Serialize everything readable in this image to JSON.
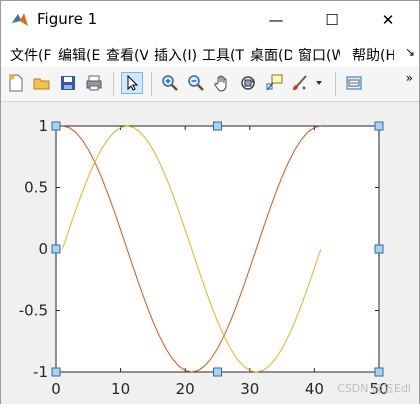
{
  "window": {
    "title": "Figure 1",
    "minimize_glyph": "—",
    "maximize_glyph": "☐",
    "close_glyph": "✕"
  },
  "menu": {
    "items": [
      "文件(F)",
      "编辑(E)",
      "查看(V)",
      "插入(I)",
      "工具(T)",
      "桌面(D)",
      "窗口(W)",
      "帮助(H)"
    ],
    "overflow_glyph": "↘"
  },
  "toolbar": {
    "buttons": [
      "new-figure-icon",
      "open-file-icon",
      "save-icon",
      "print-icon",
      "select-arrow-icon",
      "zoom-in-icon",
      "zoom-out-icon",
      "pan-hand-icon",
      "rotate-3d-icon",
      "data-cursor-icon",
      "brush-icon",
      "link-plot-icon"
    ],
    "more_glyph": "»"
  },
  "colors": {
    "series_cos": "#d95319",
    "series_sin": "#edb120",
    "handle_fill": "#a8d2f2",
    "handle_stroke": "#2b6cb0"
  },
  "chart_data": {
    "type": "line",
    "title": "",
    "xlabel": "",
    "ylabel": "",
    "xlim": [
      0,
      50
    ],
    "ylim": [
      -1,
      1
    ],
    "xticks": [
      0,
      10,
      20,
      30,
      40,
      50
    ],
    "yticks": [
      1,
      0.5,
      0,
      -0.5,
      -1
    ],
    "xtick_labels": [
      "0",
      "10",
      "20",
      "30",
      "40",
      "50"
    ],
    "ytick_labels": [
      "1",
      "0.5",
      "0",
      "-0.5",
      "-1"
    ],
    "grid": false,
    "series": [
      {
        "color": "#d95319",
        "x": [
          1,
          2,
          3,
          4,
          5,
          6,
          7,
          8,
          9,
          10,
          11,
          12,
          13,
          14,
          15,
          16,
          17,
          18,
          19,
          20,
          21,
          22,
          23,
          24,
          25,
          26,
          27,
          28,
          29,
          30,
          31,
          32,
          33,
          34,
          35,
          36,
          37,
          38,
          39,
          40,
          41
        ],
        "y": [
          1.0,
          0.988,
          0.951,
          0.891,
          0.809,
          0.707,
          0.588,
          0.454,
          0.309,
          0.156,
          0.0,
          -0.156,
          -0.309,
          -0.454,
          -0.588,
          -0.707,
          -0.809,
          -0.891,
          -0.951,
          -0.988,
          -1.0,
          -0.988,
          -0.951,
          -0.891,
          -0.809,
          -0.707,
          -0.588,
          -0.454,
          -0.309,
          -0.156,
          0.0,
          0.156,
          0.309,
          0.454,
          0.588,
          0.707,
          0.809,
          0.891,
          0.951,
          0.988,
          1.0
        ]
      },
      {
        "color": "#edb120",
        "x": [
          1,
          2,
          3,
          4,
          5,
          6,
          7,
          8,
          9,
          10,
          11,
          12,
          13,
          14,
          15,
          16,
          17,
          18,
          19,
          20,
          21,
          22,
          23,
          24,
          25,
          26,
          27,
          28,
          29,
          30,
          31,
          32,
          33,
          34,
          35,
          36,
          37,
          38,
          39,
          40,
          41
        ],
        "y": [
          0.0,
          0.156,
          0.309,
          0.454,
          0.588,
          0.707,
          0.809,
          0.891,
          0.951,
          0.988,
          1.0,
          0.988,
          0.951,
          0.891,
          0.809,
          0.707,
          0.588,
          0.454,
          0.309,
          0.156,
          0.0,
          -0.156,
          -0.309,
          -0.454,
          -0.588,
          -0.707,
          -0.809,
          -0.891,
          -0.951,
          -0.988,
          -1.0,
          -0.988,
          -0.951,
          -0.891,
          -0.809,
          -0.707,
          -0.588,
          -0.454,
          -0.309,
          -0.156,
          0.0
        ]
      }
    ]
  },
  "watermark": "CSDN @五Edl"
}
